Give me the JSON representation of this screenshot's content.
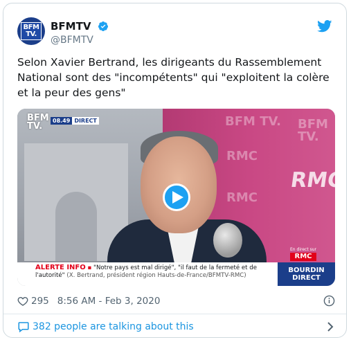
{
  "user": {
    "display_name": "BFMTV",
    "handle": "@BFMTV",
    "avatar_text_line1": "BFM",
    "avatar_text_line2": "TV."
  },
  "tweet": {
    "text": "Selon Xavier Bertrand, les dirigeants du Rassemblement National sont des \"incompétents\" qui \"exploitent la colère et la peur des gens\""
  },
  "media": {
    "logo_line1": "BFM",
    "logo_line2": "TV.",
    "time": "08.49",
    "live_label": "DIRECT",
    "alert_label": "ALERTE INFO",
    "alert_text": "\"Notre pays est mal dirigé\", \"il faut de la fermeté et de l'autorité\"",
    "alert_source": "(X. Bertrand, président région Hauts-de-France/BFMTV-RMC)",
    "rmc_small": "En direct sur",
    "rmc_logo": "RMC",
    "show_line1": "BOURDIN",
    "show_line2": "DIRECT",
    "wall_text_1": "BFM TV.",
    "wall_text_2": "RMC",
    "wall_text_big": "RMC"
  },
  "meta": {
    "likes": "295",
    "timestamp": "8:56 AM - Feb 3, 2020"
  },
  "footer": {
    "talking": "382 people are talking about this"
  },
  "colors": {
    "twitter_blue": "#1da1f2",
    "link_blue": "#1b95e0",
    "bfm_blue": "#1b3e8a",
    "rmc_red": "#e2001a"
  },
  "icons": [
    "verified-badge-icon",
    "twitter-bird-icon",
    "play-icon",
    "heart-icon",
    "info-icon",
    "speech-bubble-icon",
    "chevron-right-icon"
  ]
}
